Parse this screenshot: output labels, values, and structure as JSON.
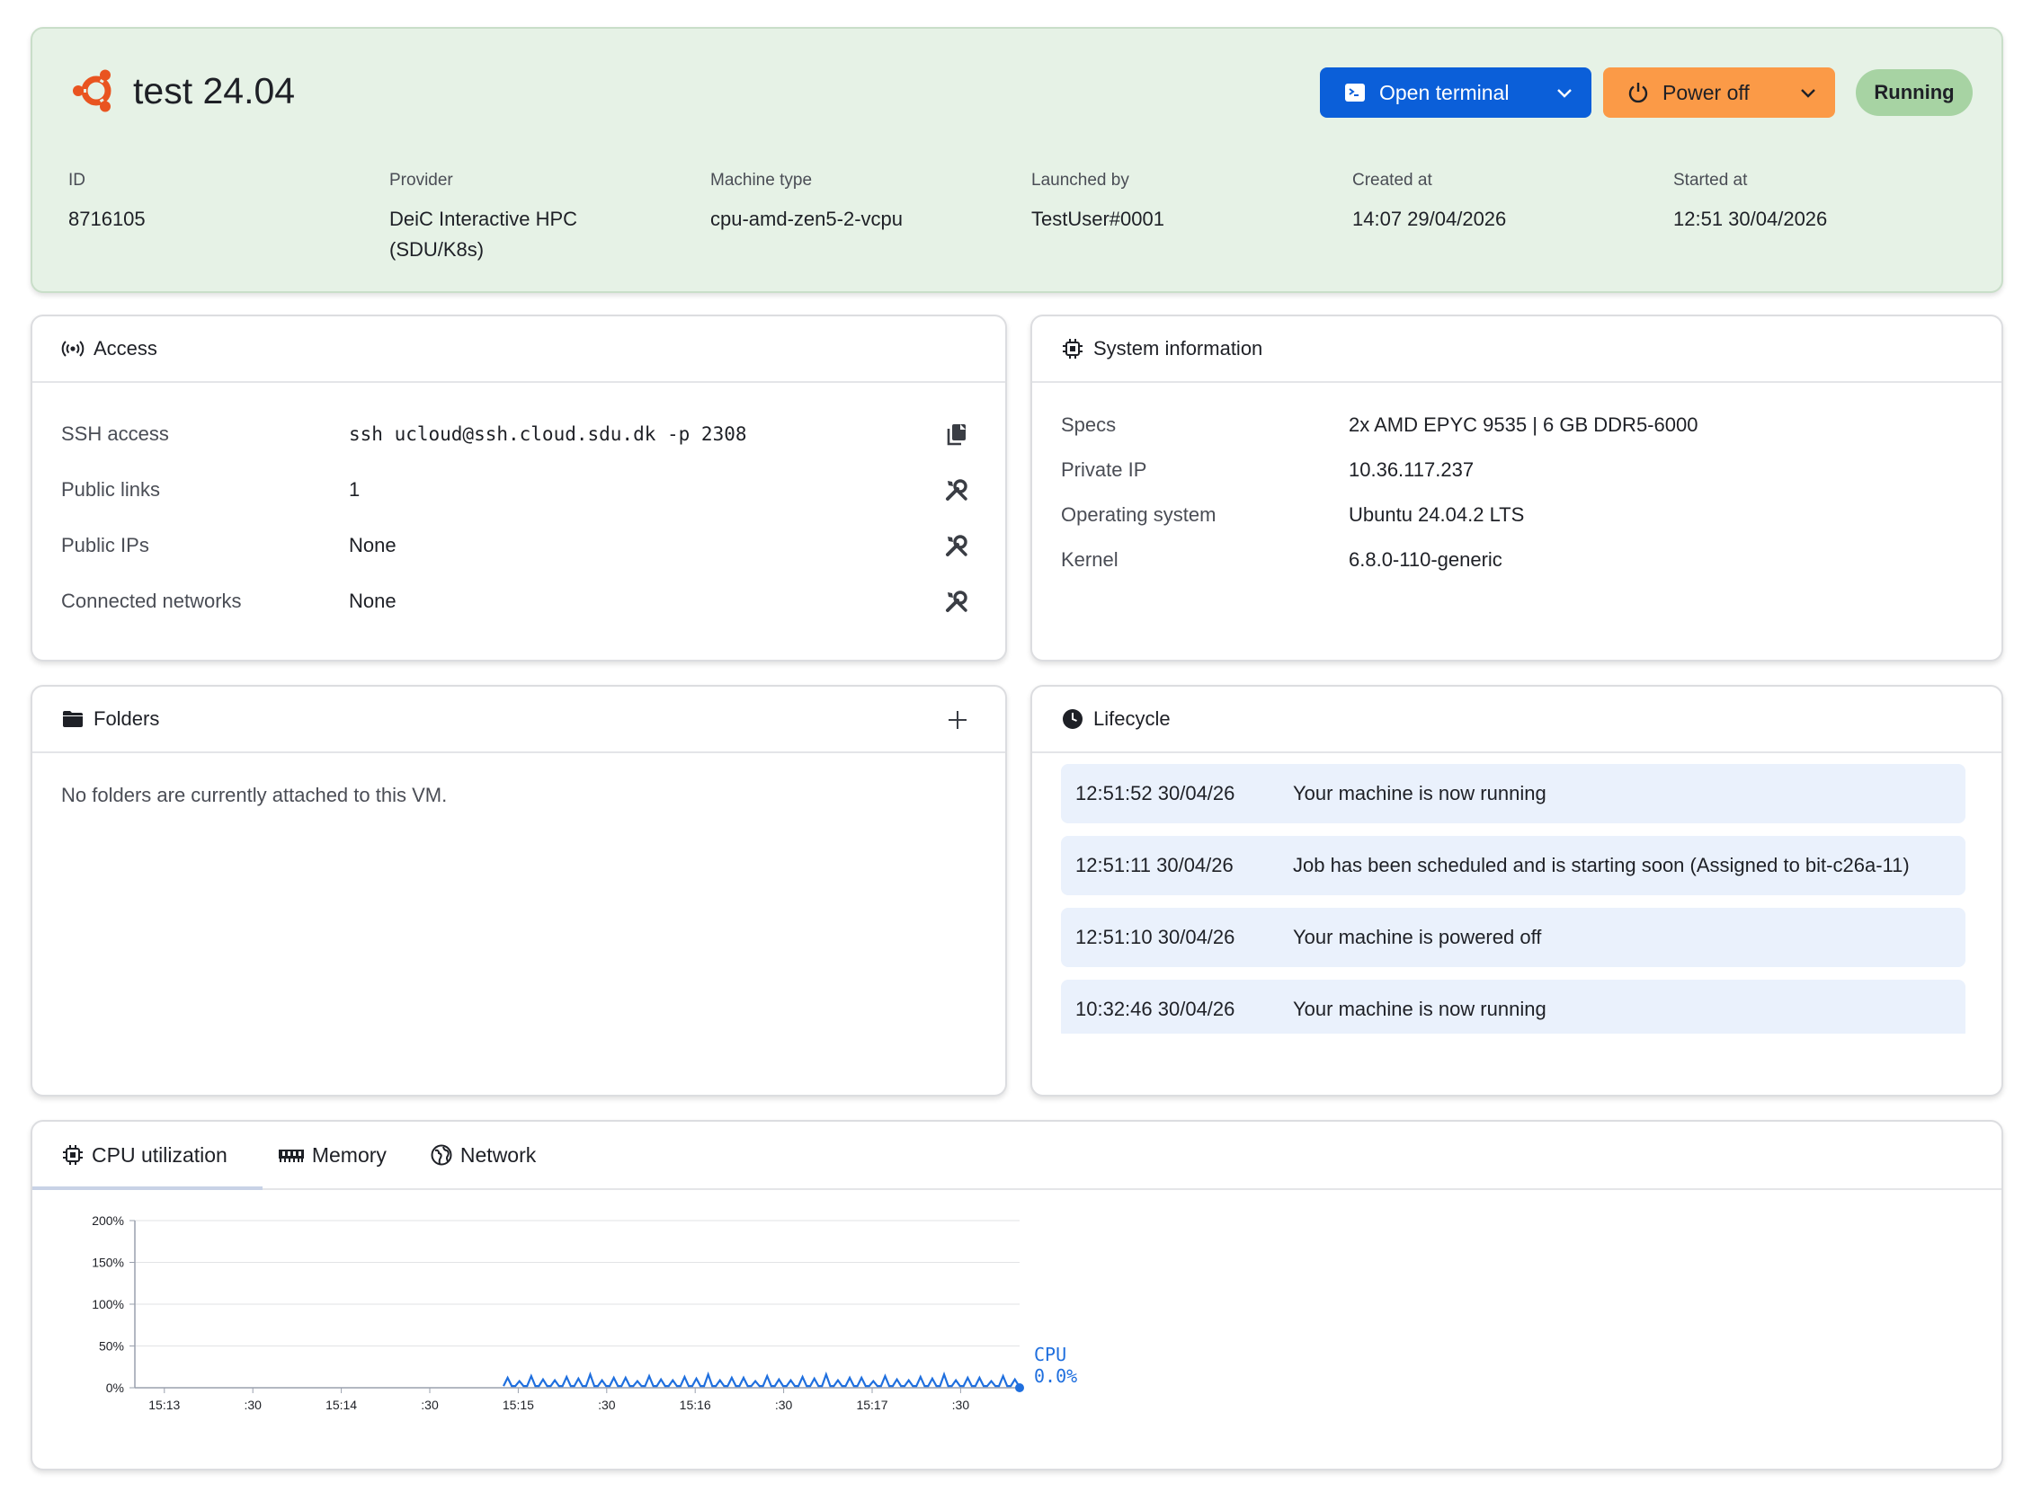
{
  "header": {
    "title": "test 24.04",
    "logo_icon": "ubuntu-logo-icon",
    "open_terminal_label": "Open terminal",
    "power_off_label": "Power off",
    "status": "Running",
    "meta": [
      {
        "label": "ID",
        "value": "8716105"
      },
      {
        "label": "Provider",
        "value": "DeiC Interactive HPC (SDU/K8s)"
      },
      {
        "label": "Machine type",
        "value": "cpu-amd-zen5-2-vcpu"
      },
      {
        "label": "Launched by",
        "value": "TestUser#0001"
      },
      {
        "label": "Created at",
        "value": "14:07 29/04/2026"
      },
      {
        "label": "Started at",
        "value": "12:51 30/04/2026"
      }
    ]
  },
  "access": {
    "title": "Access",
    "rows": [
      {
        "label": "SSH access",
        "value": "ssh ucloud@ssh.cloud.sdu.dk -p 2308",
        "action_icon": "copy-icon"
      },
      {
        "label": "Public links",
        "value": "1",
        "action_icon": "wrench-screwdriver-icon"
      },
      {
        "label": "Public IPs",
        "value": "None",
        "action_icon": "wrench-screwdriver-icon"
      },
      {
        "label": "Connected networks",
        "value": "None",
        "action_icon": "wrench-screwdriver-icon"
      }
    ]
  },
  "system_information": {
    "title": "System information",
    "rows": [
      {
        "label": "Specs",
        "value": "2x AMD EPYC 9535 | 6 GB DDR5-6000"
      },
      {
        "label": "Private IP",
        "value": "10.36.117.237"
      },
      {
        "label": "Operating system",
        "value": "Ubuntu 24.04.2 LTS"
      },
      {
        "label": "Kernel",
        "value": "6.8.0-110-generic"
      }
    ]
  },
  "folders": {
    "title": "Folders",
    "empty_text": "No folders are currently attached to this VM."
  },
  "lifecycle": {
    "title": "Lifecycle",
    "events": [
      {
        "time": "12:51:52 30/04/26",
        "message": "Your machine is now running"
      },
      {
        "time": "12:51:11 30/04/26",
        "message": "Job has been scheduled and is starting soon (Assigned to bit-c26a-11)"
      },
      {
        "time": "12:51:10 30/04/26",
        "message": "Your machine is powered off"
      },
      {
        "time": "10:32:46 30/04/26",
        "message": "Your machine is now running"
      }
    ]
  },
  "metrics": {
    "tabs": [
      {
        "label": "CPU utilization",
        "icon": "cpu-chip-icon",
        "active": true
      },
      {
        "label": "Memory",
        "icon": "memory-icon",
        "active": false
      },
      {
        "label": "Network",
        "icon": "globe-icon",
        "active": false
      }
    ]
  },
  "colors": {
    "header_bg": "#e6f2e6",
    "primary": "#0b5fd9",
    "warning": "#fb9a47",
    "status_running": "#a7d3a3",
    "lifecycle_item_bg": "#eaf1fc",
    "series": "#1f6fde"
  },
  "chart_data": {
    "type": "line",
    "series": [
      {
        "name": "CPU",
        "current_label": "0.0%",
        "color": "#1f6fde"
      }
    ],
    "x_ticks": [
      "15:13",
      ":30",
      "15:14",
      ":30",
      "15:15",
      ":30",
      "15:16",
      ":30",
      "15:17",
      ":30"
    ],
    "y_ticks": [
      "0%",
      "50%",
      "100%",
      "150%",
      "200%"
    ],
    "ylim": [
      0,
      200
    ],
    "x_range_seconds": [
      0,
      300
    ],
    "data_start_seconds": 125,
    "spike_period_seconds": 4,
    "spike_values": [
      12,
      8,
      14,
      10,
      9,
      13,
      11,
      16,
      9,
      12
    ],
    "baseline": 2,
    "grid": true
  }
}
